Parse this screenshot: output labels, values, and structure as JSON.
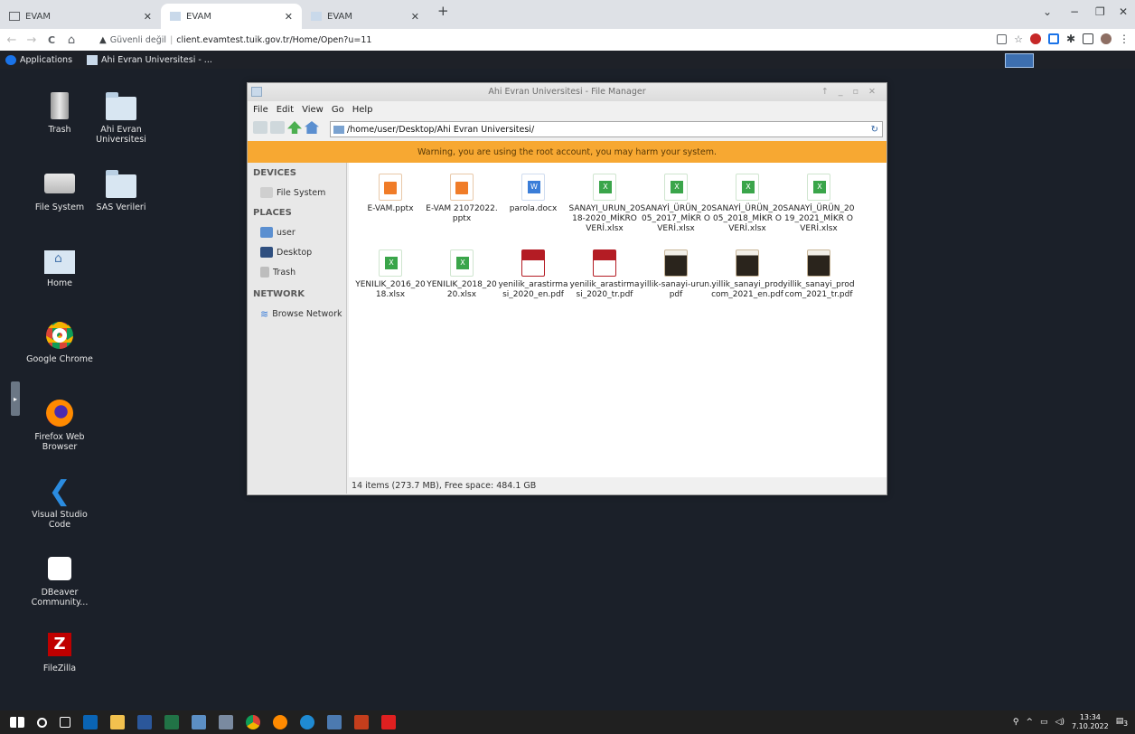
{
  "browser": {
    "tabs": [
      {
        "label": "EVAM",
        "active": false
      },
      {
        "label": "EVAM",
        "active": true
      },
      {
        "label": "EVAM",
        "active": false
      }
    ],
    "new_tab": "+",
    "window_controls": {
      "dropdown": "⌄",
      "minimize": "−",
      "restore": "❐",
      "close": "✕"
    },
    "nav": {
      "back": "←",
      "forward": "→",
      "reload": "C",
      "home": "⌂"
    },
    "address": {
      "warning_icon": "▲",
      "security_label": "Güvenli değil",
      "url": "client.evamtest.tuik.gov.tr/Home/Open?u=11"
    },
    "bookmarks": [
      {
        "label": "Applications",
        "icon": "apps-icon"
      },
      {
        "label": "Ahi Evran Universitesi - ...",
        "icon": "folder-icon"
      }
    ]
  },
  "desktop": {
    "icons": [
      {
        "label": "Trash",
        "icon": "trash-icon"
      },
      {
        "label": "Ahi Evran Universitesi",
        "icon": "folder-icon"
      },
      {
        "label": "File System",
        "icon": "drive-icon"
      },
      {
        "label": "SAS Verileri",
        "icon": "folder-icon"
      },
      {
        "label": "Home",
        "icon": "home-icon"
      },
      {
        "label": "Google Chrome",
        "icon": "chrome-icon"
      },
      {
        "label": "Firefox Web Browser",
        "icon": "firefox-icon"
      },
      {
        "label": "Visual Studio Code",
        "icon": "vscode-icon"
      },
      {
        "label": "DBeaver Community...",
        "icon": "dbeaver-icon"
      },
      {
        "label": "FileZilla",
        "icon": "filezilla-icon"
      }
    ]
  },
  "file_manager": {
    "title": "Ahi Evran Universitesi - File Manager",
    "menu": [
      "File",
      "Edit",
      "View",
      "Go",
      "Help"
    ],
    "path": "/home/user/Desktop/Ahi Evran Universitesi/",
    "warning": "Warning, you are using the root account, you may harm your system.",
    "sidebar": {
      "devices_heading": "DEVICES",
      "devices": [
        {
          "label": "File System",
          "icon": "drive-icon"
        }
      ],
      "places_heading": "PLACES",
      "places": [
        {
          "label": "user",
          "icon": "home-icon"
        },
        {
          "label": "Desktop",
          "icon": "desktop-icon"
        },
        {
          "label": "Trash",
          "icon": "trash-icon"
        }
      ],
      "network_heading": "NETWORK",
      "network": [
        {
          "label": "Browse Network",
          "icon": "wifi-icon"
        }
      ]
    },
    "files": [
      {
        "name": "E-VAM.pptx",
        "type": "pptx"
      },
      {
        "name": "E-VAM 21072022.pptx",
        "type": "pptx"
      },
      {
        "name": "parola.docx",
        "type": "docx"
      },
      {
        "name": "SANAYI_URUN_2018-2020_MİKRO VERİ.xlsx",
        "type": "xlsx"
      },
      {
        "name": "SANAYİ_ÜRÜN_2005_2017_MİKR OVERİ.xlsx",
        "type": "xlsx"
      },
      {
        "name": "SANAYİ_ÜRÜN_2005_2018_MİKR OVERİ.xlsx",
        "type": "xlsx"
      },
      {
        "name": "SANAYİ_ÜRÜN_2019_2021_MİKR OVERİ.xlsx",
        "type": "xlsx"
      },
      {
        "name": "YENILIK_2016_2018.xlsx",
        "type": "xlsx"
      },
      {
        "name": "YENILIK_2018_2020.xlsx",
        "type": "xlsx"
      },
      {
        "name": "yenilik_arastirmasi_2020_en.pdf",
        "type": "pdfred"
      },
      {
        "name": "yenilik_arastirmasi_2020_tr.pdf",
        "type": "pdfred"
      },
      {
        "name": "yillik-sanayi-urun.pdf",
        "type": "pdfdark"
      },
      {
        "name": "yillik_sanayi_prodcom_2021_en.pdf",
        "type": "pdfdark"
      },
      {
        "name": "yillik_sanayi_prodcom_2021_tr.pdf",
        "type": "pdfdark"
      }
    ],
    "status": "14 items (273.7 MB), Free space: 484.1 GB"
  },
  "taskbar": {
    "clock_time": "13:34",
    "clock_date": "7.10.2022",
    "notification_count": "3"
  }
}
